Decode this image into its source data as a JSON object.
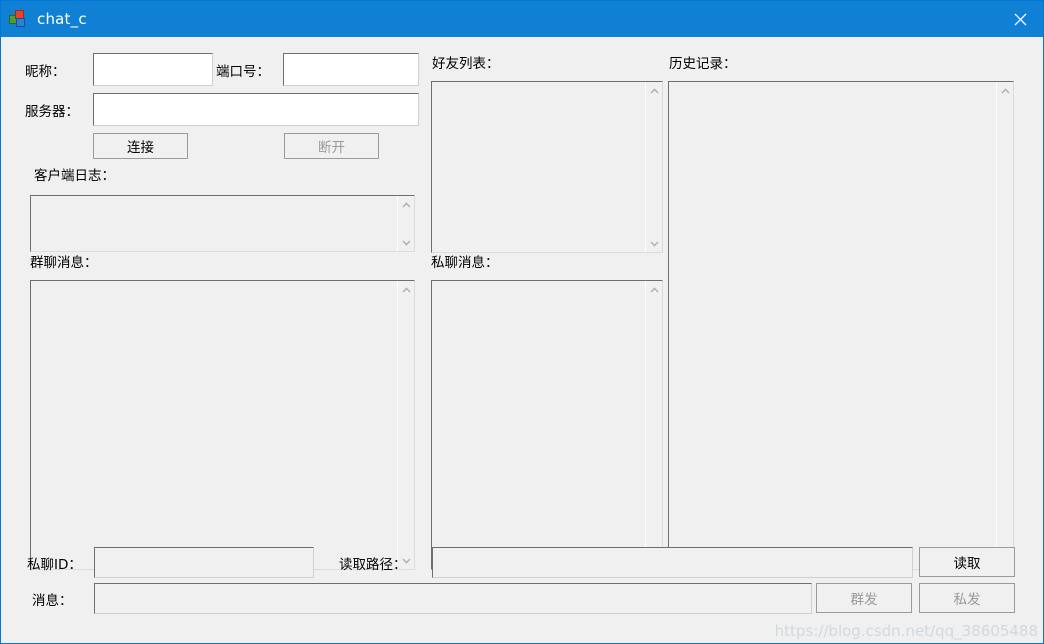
{
  "window": {
    "title": "chat_c",
    "icon": "vs-project-icon",
    "close_label": "×",
    "accent_color": "#0f80d3"
  },
  "form": {
    "nickname_label": "昵称：",
    "nickname_value": "",
    "port_label": "端口号：",
    "port_value": "",
    "server_label": "服务器：",
    "server_value": "",
    "connect_button": "连接",
    "disconnect_button": "断开"
  },
  "panels": {
    "client_log_label": "客户端日志：",
    "client_log_value": "",
    "group_chat_label": "群聊消息：",
    "group_chat_value": "",
    "friend_list_label": "好友列表：",
    "friend_list_value": "",
    "private_chat_label": "私聊消息：",
    "private_chat_value": "",
    "history_label": "历史记录：",
    "history_value": ""
  },
  "bottom": {
    "private_id_label": "私聊ID：",
    "private_id_value": "",
    "read_path_label": "读取路径：",
    "read_path_value": "",
    "message_label": "消息：",
    "message_value": "",
    "read_button": "读取",
    "group_send_button": "群发",
    "private_send_button": "私发"
  },
  "watermark": "https://blog.csdn.net/qq_38605488"
}
